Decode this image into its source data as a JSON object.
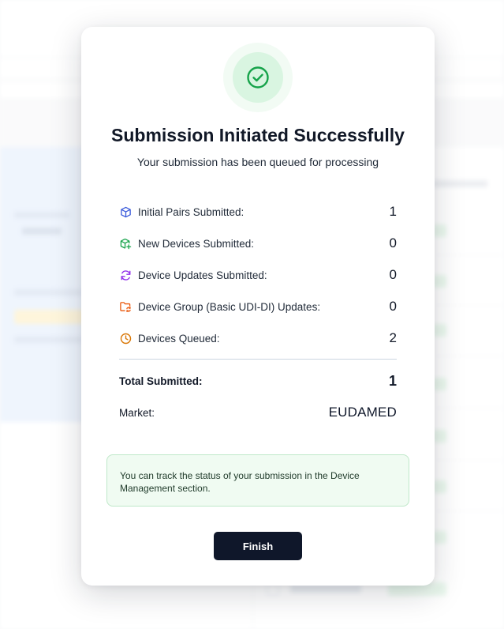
{
  "modal": {
    "title": "Submission Initiated Successfully",
    "subtitle": "Your submission has been queued for processing",
    "stats": [
      {
        "label": "Initial Pairs Submitted:",
        "value": "1",
        "icon": "cube-icon",
        "color": "#3b5bdb"
      },
      {
        "label": "New Devices Submitted:",
        "value": "0",
        "icon": "cube-plus-icon",
        "color": "#16a34a"
      },
      {
        "label": "Device Updates Submitted:",
        "value": "0",
        "icon": "refresh-icon",
        "color": "#9333ea"
      },
      {
        "label": "Device Group (Basic UDI-DI) Updates:",
        "value": "0",
        "icon": "folder-sync-icon",
        "color": "#ea580c"
      },
      {
        "label": "Devices Queued:",
        "value": "2",
        "icon": "clock-icon",
        "color": "#d97706"
      }
    ],
    "total": {
      "label": "Total Submitted:",
      "value": "1"
    },
    "market": {
      "label": "Market:",
      "value": "EUDAMED"
    },
    "info": "You can track the status of your submission in the Device Management section.",
    "finish_label": "Finish"
  },
  "colors": {
    "success_green": "#16a34a",
    "button_dark": "#0f172a",
    "info_bg": "#f0fbf2"
  }
}
